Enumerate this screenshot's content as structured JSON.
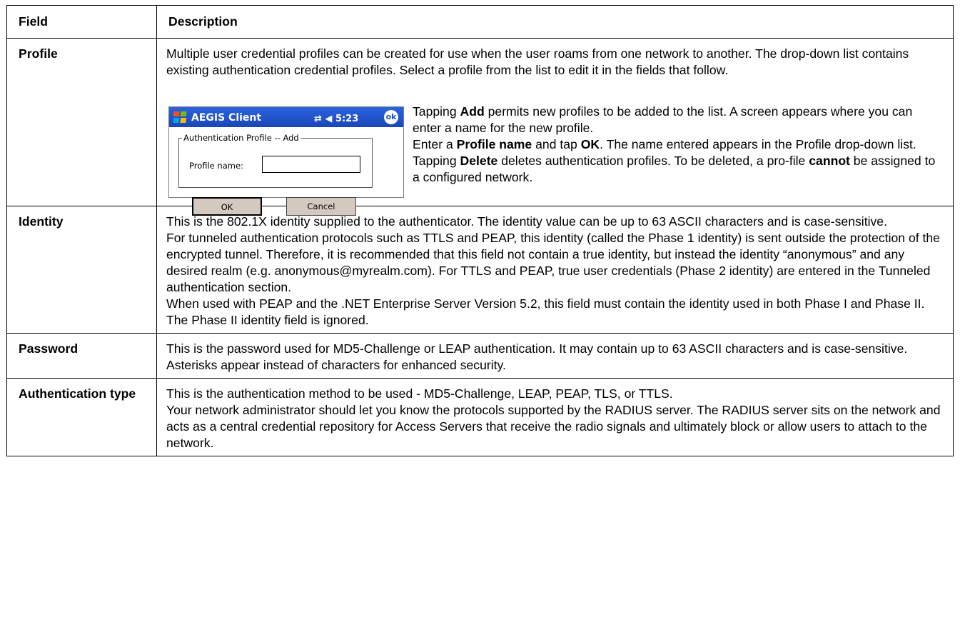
{
  "table": {
    "header_field": "Field",
    "header_description": "Description"
  },
  "profile": {
    "field": "Profile",
    "intro": "Multiple user credential profiles can be created for use when the user roams from one network to another. The drop-down list contains existing authentication credential profiles. Select a profile from the list to edit it in the fields that follow.",
    "add_pre": "Tapping ",
    "add_bold": "Add",
    "add_post": " permits new profiles to be added to the list. A screen appears where you can enter a name for the new profile.",
    "enter_pre": "Enter a ",
    "enter_bold1": "Profile name",
    "enter_mid": " and tap ",
    "enter_bold2": "OK",
    "enter_post": ". The name entered appears in the Profile drop-down list.",
    "delete_pre": "Tapping ",
    "delete_bold": "Delete",
    "delete_mid": " deletes authentication profiles. To be deleted, a pro-file ",
    "delete_bold2": "cannot",
    "delete_post": " be assigned to a configured network."
  },
  "screenshot": {
    "title": "AEGIS Client",
    "time": "5:23",
    "status_icons": "⇄ ◀ 5:23",
    "ok_badge": "ok",
    "group_label": "Authentication Profile -- Add",
    "profile_name_label": "Profile name:",
    "profile_name_value": "",
    "ok_button": "OK",
    "cancel_button": "Cancel"
  },
  "identity": {
    "field": "Identity",
    "p1": "This is the 802.1X identity supplied to the authenticator. The identity value can be up to 63 ASCII characters and is case-sensitive.",
    "p2": "For tunneled authentication protocols such as TTLS and PEAP, this identity (called the Phase 1 identity) is sent outside the protection of the encrypted tunnel. Therefore, it is recommended that this field not contain a true identity, but instead the identity “anonymous” and any desired realm (e.g. anonymous@myrealm.com). For TTLS and PEAP, true user credentials (Phase 2 identity) are entered in the Tunneled authentication section.",
    "p3": "When used with PEAP and the .NET Enterprise Server Version 5.2, this field must contain the identity used in both Phase I and Phase II. The Phase II identity field is ignored."
  },
  "password": {
    "field": "Password",
    "p1": "This is the password used for MD5-Challenge or LEAP authentication. It may contain up to 63 ASCII characters and is case-sensitive. Asterisks appear instead of characters for enhanced security."
  },
  "auth_type": {
    "field": "Authentication type",
    "p1": "This is the authentication method to be used - MD5-Challenge, LEAP, PEAP, TLS, or TTLS.",
    "p2": "Your network administrator should let you know the protocols supported by the RADIUS server. The RADIUS server sits on the network and acts as a central credential repository for Access Servers that receive the radio signals and ultimately block or allow users to attach to the network."
  },
  "colors": {
    "titlebar": "#1f4fc6",
    "button_face": "#d4c9bf"
  }
}
